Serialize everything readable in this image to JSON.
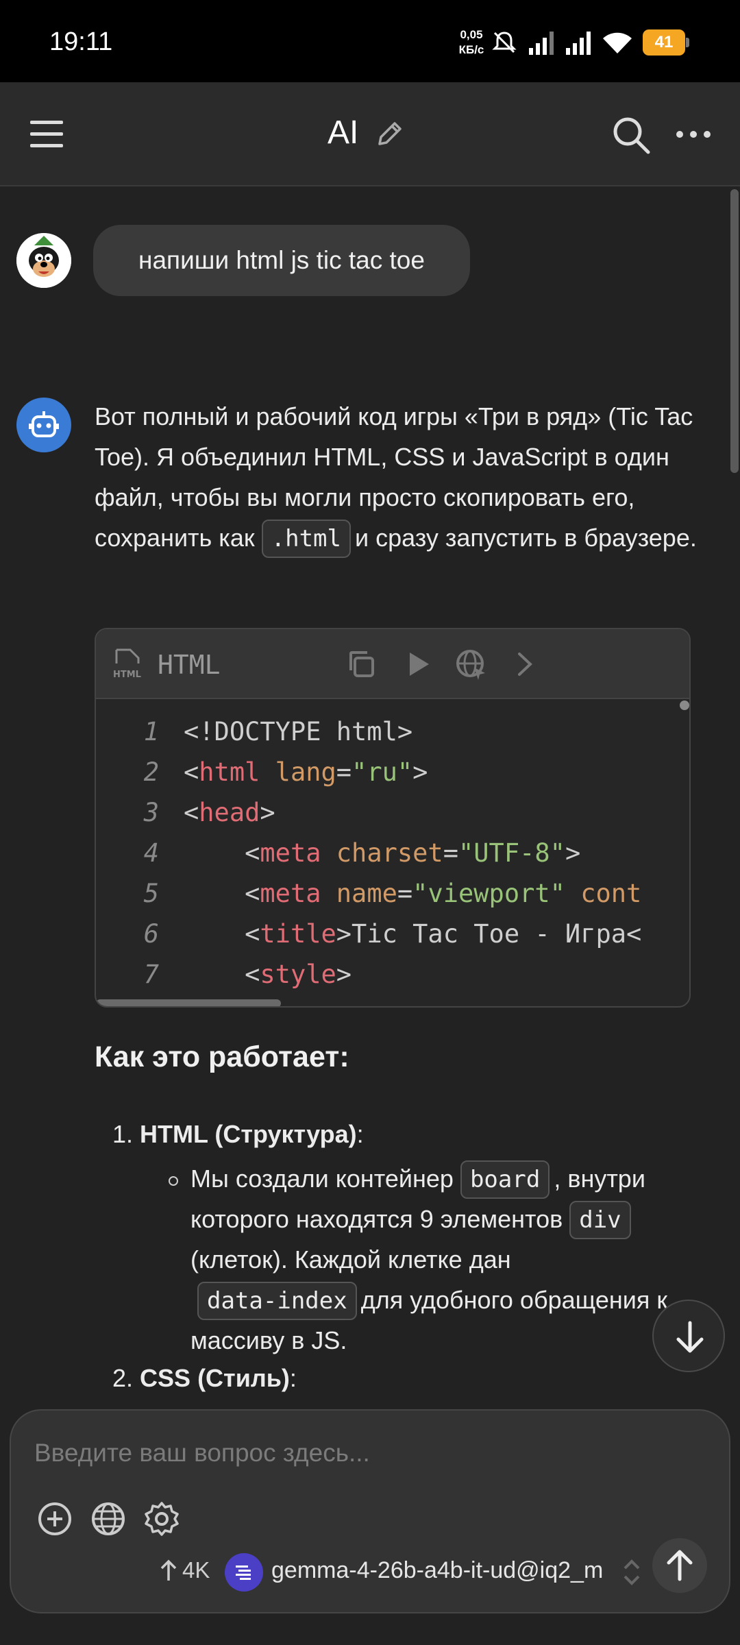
{
  "status_bar": {
    "time": "19:11",
    "net_speed_value": "0,05",
    "net_speed_unit": "КБ/с",
    "battery": "41"
  },
  "app_bar": {
    "title": "AI"
  },
  "chat": {
    "user_message": "напиши html js tic tac toe",
    "assistant_intro_before": "Вот полный и рабочий код игры «Три в ряд» (Tic Tac Toe). Я объединил HTML, CSS и JavaScript в один файл, чтобы вы могли просто скопировать его, сохранить как",
    "assistant_intro_code": ".html",
    "assistant_intro_after": "и сразу запустить в браузере.",
    "code_block": {
      "language": "HTML",
      "lines": [
        {
          "n": "1",
          "parts": [
            {
              "t": "<!DOCTYPE html>",
              "c": "punc"
            }
          ]
        },
        {
          "n": "2",
          "parts": [
            {
              "t": "<",
              "c": "punc"
            },
            {
              "t": "html",
              "c": "tag"
            },
            {
              "t": " ",
              "c": "punc"
            },
            {
              "t": "lang",
              "c": "attr"
            },
            {
              "t": "=",
              "c": "punc"
            },
            {
              "t": "\"ru\"",
              "c": "str"
            },
            {
              "t": ">",
              "c": "punc"
            }
          ]
        },
        {
          "n": "3",
          "parts": [
            {
              "t": "<",
              "c": "punc"
            },
            {
              "t": "head",
              "c": "tag"
            },
            {
              "t": ">",
              "c": "punc"
            }
          ]
        },
        {
          "n": "4",
          "parts": [
            {
              "t": "    <",
              "c": "punc"
            },
            {
              "t": "meta",
              "c": "tag"
            },
            {
              "t": " ",
              "c": "punc"
            },
            {
              "t": "charset",
              "c": "attr"
            },
            {
              "t": "=",
              "c": "punc"
            },
            {
              "t": "\"UTF-8\"",
              "c": "str"
            },
            {
              "t": ">",
              "c": "punc"
            }
          ]
        },
        {
          "n": "5",
          "parts": [
            {
              "t": "    <",
              "c": "punc"
            },
            {
              "t": "meta",
              "c": "tag"
            },
            {
              "t": " ",
              "c": "punc"
            },
            {
              "t": "name",
              "c": "attr"
            },
            {
              "t": "=",
              "c": "punc"
            },
            {
              "t": "\"viewport\"",
              "c": "str"
            },
            {
              "t": " ",
              "c": "punc"
            },
            {
              "t": "cont",
              "c": "attr"
            }
          ]
        },
        {
          "n": "6",
          "parts": [
            {
              "t": "    <",
              "c": "punc"
            },
            {
              "t": "title",
              "c": "tag"
            },
            {
              "t": ">Tic Tac Toe - Игра<",
              "c": "punc"
            }
          ]
        },
        {
          "n": "7",
          "parts": [
            {
              "t": "    <",
              "c": "punc"
            },
            {
              "t": "style",
              "c": "tag"
            },
            {
              "t": ">",
              "c": "punc"
            }
          ]
        }
      ]
    },
    "section_heading": "Как это работает:",
    "list": [
      {
        "number": "1.",
        "title": "HTML (Структура)",
        "suffix": ":"
      },
      {
        "number": "2.",
        "title": "CSS (Стиль)",
        "suffix": ":"
      }
    ],
    "sub_item": {
      "text_1": "Мы создали контейнер",
      "code_1": "board",
      "text_2": ", внутри которого находятся 9 элементов",
      "code_2": "div",
      "text_3": "(клеток). Каждой клетке дан",
      "code_3": "data-index",
      "text_4": "для удобного обращения к массиву в JS."
    }
  },
  "composer": {
    "placeholder": "Введите ваш вопрос здесь...",
    "context_size": "4K",
    "model_name": "gemma-4-26b-a4b-it-ud@iq2_m"
  },
  "colors": {
    "accent_blue": "#3a7bd5",
    "battery": "#f5a623",
    "model_icon": "#4b3fc6"
  }
}
